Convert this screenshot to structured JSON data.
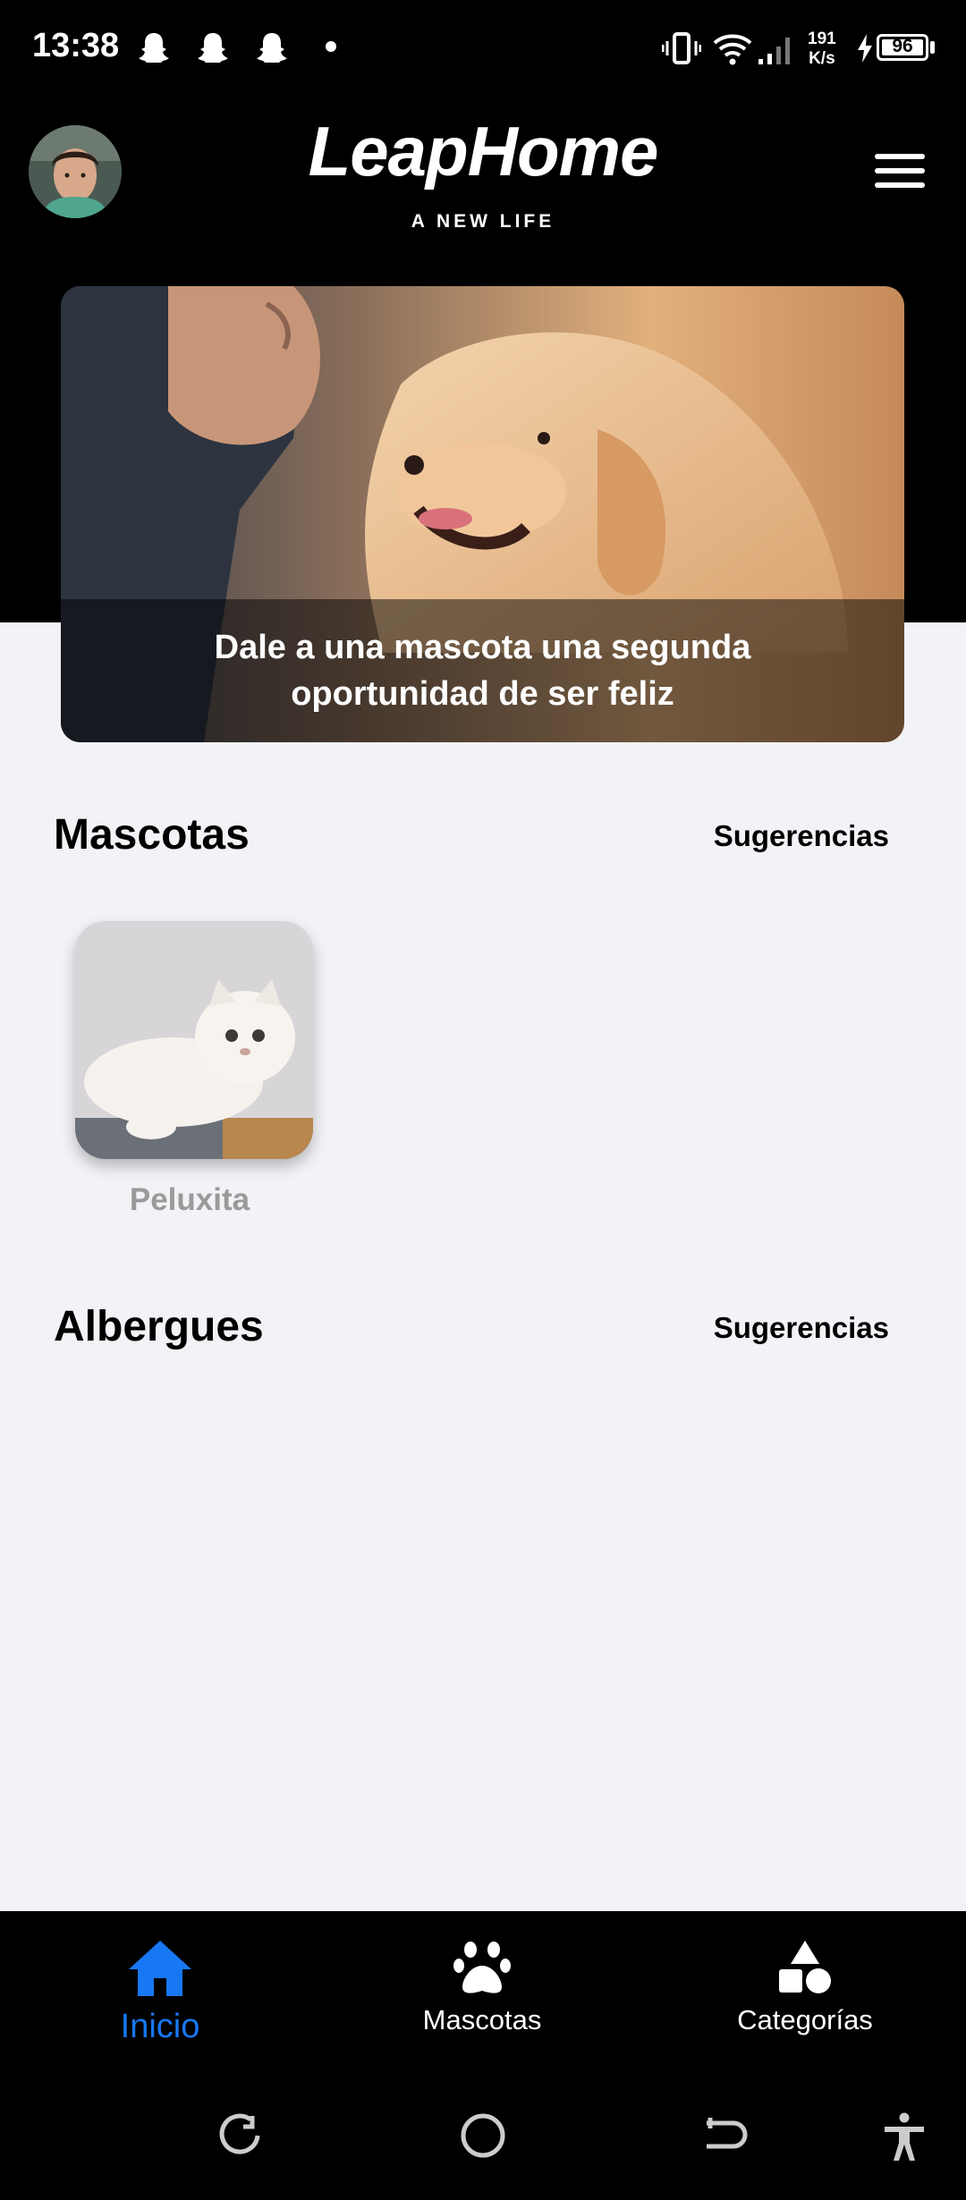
{
  "status_bar": {
    "time": "13:38",
    "net_speed_value": "191",
    "net_speed_unit": "K/s",
    "battery": "96",
    "notification_icons": [
      "snapchat-icon",
      "snapchat-icon",
      "snapchat-icon"
    ]
  },
  "header": {
    "logo_text": "LeapHome",
    "tagline": "A NEW LIFE"
  },
  "hero": {
    "caption": "Dale a una mascota una segunda oportunidad de ser feliz"
  },
  "sections": {
    "pets": {
      "title": "Mascotas",
      "link": "Sugerencias",
      "items": [
        {
          "name": "Peluxita"
        }
      ]
    },
    "shelters": {
      "title": "Albergues",
      "link": "Sugerencias"
    }
  },
  "tabbar": {
    "tabs": [
      {
        "label": "Inicio",
        "icon": "home-icon",
        "active": true
      },
      {
        "label": "Mascotas",
        "icon": "paw-icon",
        "active": false
      },
      {
        "label": "Categorías",
        "icon": "categories-icon",
        "active": false
      }
    ]
  },
  "colors": {
    "accent": "#1877f2",
    "header_bg": "#000000",
    "page_bg": "#f2f2f7"
  }
}
